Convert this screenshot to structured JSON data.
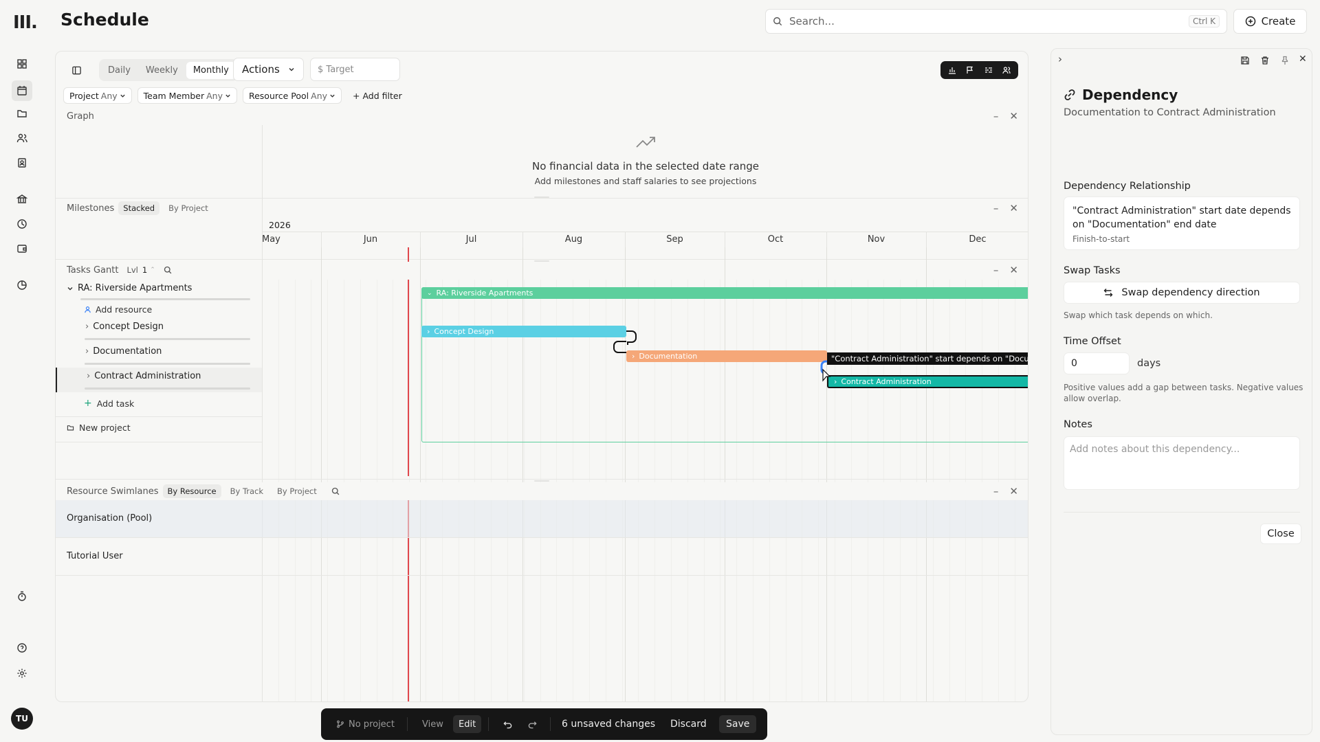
{
  "app": {
    "logo": "III.",
    "page_title": "Schedule"
  },
  "search": {
    "placeholder": "Search...",
    "shortcut": "Ctrl K"
  },
  "create_label": "Create",
  "rail": {
    "icons": [
      "dashboard-icon",
      "calendar-icon",
      "folder-icon",
      "people-icon",
      "contacts-icon",
      "bank-icon",
      "clock-icon",
      "wallet-icon",
      "pie-chart-icon",
      "timer-icon",
      "help-icon",
      "settings-icon"
    ],
    "avatar": "TU"
  },
  "toolbar": {
    "views": [
      "Daily",
      "Weekly",
      "Monthly"
    ],
    "active_view": "Monthly",
    "actions_label": "Actions",
    "target_label": "$ Target"
  },
  "filters": [
    {
      "label": "Project",
      "value": "Any"
    },
    {
      "label": "Team Member",
      "value": "Any"
    },
    {
      "label": "Resource Pool",
      "value": "Any"
    }
  ],
  "add_filter": "+ Add filter",
  "graph": {
    "title": "Graph",
    "empty_title": "No financial data in the selected date range",
    "empty_sub": "Add milestones and staff salaries to see projections"
  },
  "milestones": {
    "title": "Milestones",
    "tabs": [
      "Stacked",
      "By Project"
    ],
    "active_tab": "Stacked"
  },
  "timeline": {
    "year": "2026",
    "months": [
      "May",
      "Jun",
      "Jul",
      "Aug",
      "Sep",
      "Oct",
      "Nov",
      "Dec"
    ]
  },
  "gantt": {
    "title": "Tasks Gantt",
    "level_label": "Lvl",
    "level_value": "1",
    "project": "RA: Riverside Apartments",
    "add_resource": "Add resource",
    "tasks": [
      "Concept Design",
      "Documentation",
      "Contract Administration"
    ],
    "add_task": "Add task",
    "new_project": "New project",
    "bars": {
      "project": "RA: Riverside Apartments",
      "concept": "Concept Design",
      "documentation": "Documentation",
      "contract": "Contract Administration"
    },
    "tooltip": "\"Contract Administration\" start depends on \"Documentation"
  },
  "swimlanes": {
    "title": "Resource Swimlanes",
    "tabs": [
      "By Resource",
      "By Track",
      "By Project"
    ],
    "active_tab": "By Resource",
    "rows": [
      "Organisation (Pool)",
      "Tutorial User"
    ]
  },
  "bottom_bar": {
    "project": "No project",
    "view": "View",
    "edit": "Edit",
    "unsaved": "6 unsaved changes",
    "discard": "Discard",
    "save": "Save"
  },
  "panel": {
    "title": "Dependency",
    "subtitle": "Documentation to Contract Administration",
    "relationship_label": "Dependency Relationship",
    "relationship_text": "\"Contract Administration\" start date depends on \"Documentation\" end date",
    "relationship_type": "Finish-to-start",
    "swap_label": "Swap Tasks",
    "swap_button": "Swap dependency direction",
    "swap_help": "Swap which task depends on which.",
    "offset_label": "Time Offset",
    "offset_value": "0",
    "offset_unit": "days",
    "offset_help": "Positive values add a gap between tasks. Negative values allow overlap.",
    "notes_label": "Notes",
    "notes_placeholder": "Add notes about this dependency...",
    "close_button": "Close"
  },
  "colors": {
    "project_bar": "#5ccf9d",
    "concept_bar": "#5bd0e4",
    "documentation_bar": "#f5a778",
    "contract_bar": "#14b8a6",
    "today_line": "#e0474c",
    "connector": "#3b82f6"
  }
}
